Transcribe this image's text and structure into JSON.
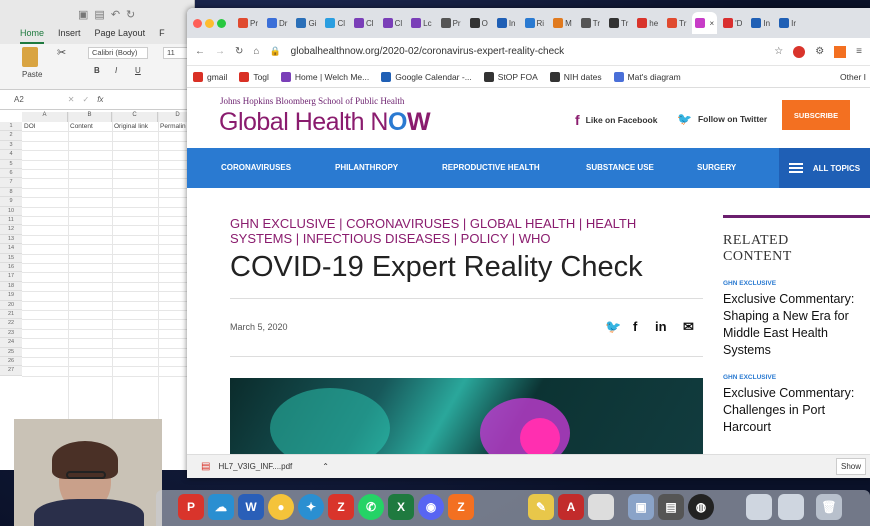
{
  "excel": {
    "tabs": [
      "Home",
      "Insert",
      "Page Layout",
      "F"
    ],
    "font_name": "Calibri (Body)",
    "font_size": "11",
    "paste_label": "Paste",
    "name_box": "A2",
    "fx_label": "fx",
    "columns": [
      "A",
      "B",
      "C",
      "D"
    ],
    "row1": [
      "DOI",
      "Content",
      "Original link",
      "Permalin"
    ],
    "rows": [
      "1",
      "2",
      "3",
      "4",
      "5",
      "6",
      "7",
      "8",
      "9",
      "10",
      "11",
      "12",
      "13",
      "14",
      "15",
      "16",
      "17",
      "18",
      "19",
      "20",
      "21",
      "22",
      "23",
      "24",
      "25",
      "26",
      "27"
    ]
  },
  "browser": {
    "tabs": [
      {
        "label": "Pr",
        "color": "#e04a2f"
      },
      {
        "label": "Dr",
        "color": "#3b6fd8"
      },
      {
        "label": "Gi",
        "color": "#2a6fb8"
      },
      {
        "label": "Cl",
        "color": "#2a9ee0"
      },
      {
        "label": "Cl",
        "color": "#7a3fb8"
      },
      {
        "label": "Cl",
        "color": "#7a3fb8"
      },
      {
        "label": "Lc",
        "color": "#7a3fb8"
      },
      {
        "label": "Pr",
        "color": "#555555"
      },
      {
        "label": "O",
        "color": "#333333"
      },
      {
        "label": "In",
        "color": "#1f5fb5"
      },
      {
        "label": "Ri",
        "color": "#2a7ad1"
      },
      {
        "label": "M",
        "color": "#e07a1f"
      },
      {
        "label": "Tr",
        "color": "#555555"
      },
      {
        "label": "Tr",
        "color": "#333333"
      },
      {
        "label": "he",
        "color": "#d9342b"
      },
      {
        "label": "Tr",
        "color": "#e04a2f"
      },
      {
        "label": "",
        "color": "#c73cc7"
      },
      {
        "label": "'D",
        "color": "#d92f2f"
      },
      {
        "label": "In",
        "color": "#1f5fb5"
      },
      {
        "label": "Ir",
        "color": "#1f5fb5"
      }
    ],
    "url": "globalhealthnow.org/2020-02/coronavirus-expert-reality-check",
    "bookmarks": [
      {
        "label": "gmail",
        "color": "#d93025"
      },
      {
        "label": "Togl",
        "color": "#d93025"
      },
      {
        "label": "Home | Welch Me...",
        "color": "#7a3fb8"
      },
      {
        "label": "Google Calendar -...",
        "color": "#1f5fb5"
      },
      {
        "label": "StOP FOA",
        "color": "#333333"
      },
      {
        "label": "NIH dates",
        "color": "#333333"
      },
      {
        "label": "Mat's diagram",
        "color": "#4a6fd8"
      }
    ],
    "other_bookmarks": "Other I"
  },
  "site": {
    "institution": "Johns Hopkins Bloomberg School of Public Health",
    "brand_regular": "Global Health N",
    "brand_o": "O",
    "brand_end": "W",
    "facebook": "Like on Facebook",
    "twitter": "Follow on Twitter",
    "subscribe": "SUBSCRIBE",
    "nav": [
      "CORONAVIRUSES",
      "PHILANTHROPY",
      "REPRODUCTIVE HEALTH",
      "SUBSTANCE USE",
      "SURGERY"
    ],
    "all_topics": "ALL TOPICS",
    "categories": "GHN EXCLUSIVE | CORONAVIRUSES | GLOBAL HEALTH | HEALTH SYSTEMS | INFECTIOUS DISEASES | POLICY | WHO",
    "title": "COVID-19 Expert Reality Check",
    "date": "March 5, 2020",
    "related_heading_1": "RELATED",
    "related_heading_2": "CONTENT",
    "related": [
      {
        "tag": "GHN EXCLUSIVE",
        "text": "Exclusive Commentary: Shaping a New Era for Middle East Health Systems"
      },
      {
        "tag": "GHN EXCLUSIVE",
        "text": "Exclusive Commentary: Challenges in Port Harcourt"
      }
    ]
  },
  "download": {
    "file": "HL7_V3IG_INF....pdf",
    "show_all": "Show"
  },
  "colors": {
    "brand": "#8a1c6e",
    "nav": "#2a7ad1",
    "subscribe": "#f37021"
  }
}
